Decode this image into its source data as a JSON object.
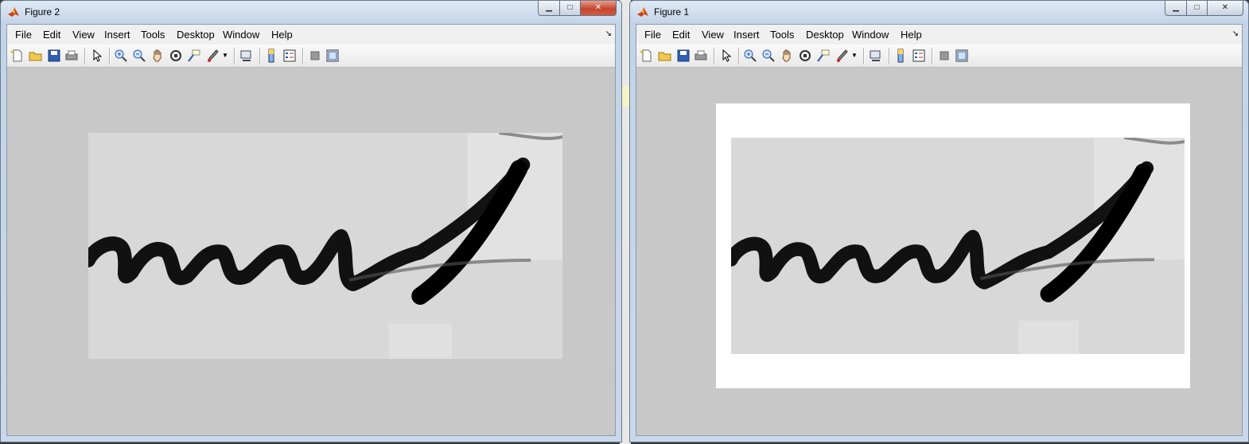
{
  "windows": [
    {
      "id": "win2",
      "title": "Figure 2",
      "controls": {
        "minimize": "▁",
        "maximize": "□",
        "close": "✕"
      },
      "menu": [
        "File",
        "Edit",
        "View",
        "Insert",
        "Tools",
        "Desktop",
        "Window",
        "Help"
      ],
      "menu_overflow_icon": "chevron-icon",
      "toolbar_icons": [
        "new-figure-icon",
        "open-file-icon",
        "save-icon",
        "print-icon",
        "edit-plot-icon",
        "zoom-in-icon",
        "zoom-out-icon",
        "pan-icon",
        "rotate-3d-icon",
        "data-cursor-icon",
        "brush-icon",
        "brush-dropdown-icon",
        "link-plot-icon",
        "insert-colorbar-icon",
        "insert-legend-icon",
        "hide-plot-tools-icon",
        "show-plot-tools-icon"
      ],
      "image": {
        "background": "#d8d8d8",
        "stroke": "#000000"
      }
    },
    {
      "id": "win1",
      "title": "Figure 1",
      "controls": {
        "minimize": "▁",
        "maximize": "□",
        "close": "✕"
      },
      "menu": [
        "File",
        "Edit",
        "View",
        "Insert",
        "Tools",
        "Desktop",
        "Window",
        "Help"
      ],
      "menu_overflow_icon": "chevron-icon",
      "toolbar_icons": [
        "new-figure-icon",
        "open-file-icon",
        "save-icon",
        "print-icon",
        "edit-plot-icon",
        "zoom-in-icon",
        "zoom-out-icon",
        "pan-icon",
        "rotate-3d-icon",
        "data-cursor-icon",
        "brush-icon",
        "brush-dropdown-icon",
        "link-plot-icon",
        "insert-colorbar-icon",
        "insert-legend-icon",
        "hide-plot-tools-icon",
        "show-plot-tools-icon"
      ],
      "image": {
        "background": "#d8d8d8",
        "stroke": "#000000",
        "axes_background": "#ffffff"
      }
    }
  ],
  "colors": {
    "figure_background": "#c8c8c8",
    "close_button_active": "#c6452e"
  }
}
